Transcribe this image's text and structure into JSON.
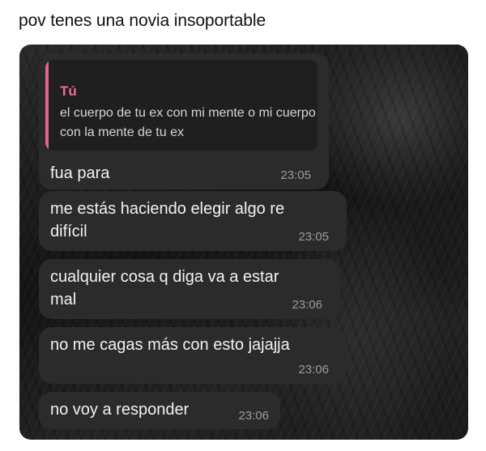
{
  "post": {
    "caption": "pov tenes una novia insoportable"
  },
  "chat": {
    "messages": [
      {
        "reply": {
          "author": "Tú",
          "text": "el cuerpo de tu ex con mi mente o mi cuerpo con la mente de tu ex"
        },
        "text": "fua para",
        "time": "23:05"
      },
      {
        "lines": [
          "me estás haciendo elegir algo re",
          "difícil"
        ],
        "time": "23:05"
      },
      {
        "lines": [
          "cualquier cosa q diga va a estar",
          "mal"
        ],
        "time": "23:06"
      },
      {
        "text": "no me cagas más con esto jajajja",
        "time": "23:06"
      },
      {
        "text": "no voy a responder",
        "time": "23:06"
      }
    ]
  },
  "colors": {
    "reply_accent": "#e8628c",
    "reply_author": "#f06a97",
    "bubble": "#2b2b2c"
  }
}
